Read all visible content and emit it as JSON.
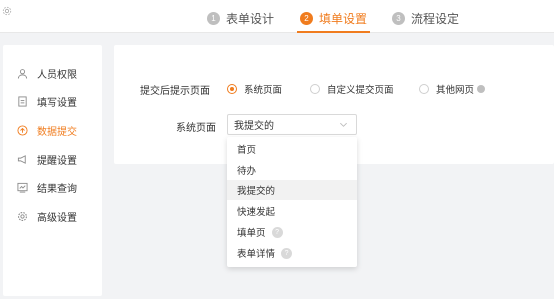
{
  "header": {
    "steps": [
      {
        "num": "1",
        "label": "表单设计"
      },
      {
        "num": "2",
        "label": "填单设置"
      },
      {
        "num": "3",
        "label": "流程设定"
      }
    ],
    "active_step": 1
  },
  "sidebar": {
    "items": [
      {
        "label": "人员权限",
        "icon": "person-icon"
      },
      {
        "label": "填写设置",
        "icon": "document-icon"
      },
      {
        "label": "数据提交",
        "icon": "upload-icon"
      },
      {
        "label": "提醒设置",
        "icon": "megaphone-icon"
      },
      {
        "label": "结果查询",
        "icon": "chart-icon"
      },
      {
        "label": "高级设置",
        "icon": "gear-icon"
      }
    ],
    "active_index": 2
  },
  "form": {
    "prompt_label": "提交后提示页面",
    "radio_options": [
      "系统页面",
      "自定义提交页面",
      "其他网页"
    ],
    "selected_radio": 0,
    "system_page_label": "系统页面",
    "select_value": "我提交的"
  },
  "dropdown": {
    "options": [
      {
        "label": "首页"
      },
      {
        "label": "待办"
      },
      {
        "label": "我提交的"
      },
      {
        "label": "快速发起"
      },
      {
        "label": "填单页",
        "help": "?"
      },
      {
        "label": "表单详情",
        "help": "?"
      }
    ],
    "hover_index": 2
  },
  "colors": {
    "accent": "#f07c1e",
    "page_bg": "#f2f3f5"
  }
}
